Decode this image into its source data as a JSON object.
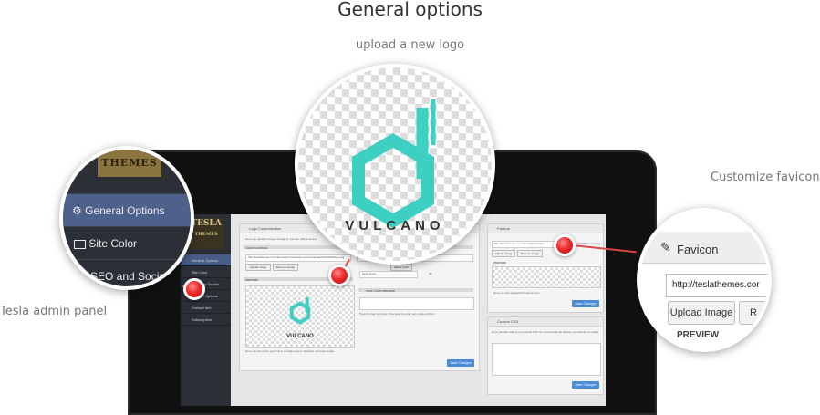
{
  "header": {
    "title": "General options",
    "subtitle": "upload a new logo"
  },
  "captions": {
    "favicon": "Customize favicon",
    "admin": "Tesla admin panel"
  },
  "lens_left": {
    "brand": "THEMES",
    "items": [
      {
        "label": "General Options",
        "icon": "gear-icon",
        "active": true
      },
      {
        "label": "Site Color",
        "icon": "image-icon",
        "active": false
      },
      {
        "label": "SEO and Socials",
        "icon": "",
        "active": false
      }
    ]
  },
  "lens_center": {
    "logo_text": "VULCANO",
    "logo_color": "#3ecfc3"
  },
  "lens_right": {
    "heading": "Favicon",
    "url_value": "http://teslathemes.cor",
    "upload_button": "Upload Image",
    "remove_button_partial": "R",
    "preview_label": "PREVIEW"
  },
  "admin": {
    "brand_top": "TESLA",
    "brand_bottom": "THEMES",
    "sidebar": [
      {
        "label": "General Options",
        "active": true
      },
      {
        "label": "Site Color",
        "active": false
      },
      {
        "label": "SEO and Socials",
        "active": false
      },
      {
        "label": "Custom Options",
        "active": false
      },
      {
        "label": "Contact Info",
        "active": false
      },
      {
        "label": "Subscription",
        "active": false
      }
    ],
    "logo_panel": {
      "heading": "Logo Customization",
      "intro": "Here you upload a image as logo or you can write it as text",
      "logo_as_image": "LOGO AS IMAGE",
      "logo_url": "http://teslathemes.com/demo/wp/vulcano/wp-content/uploads/2013/08/logo.png",
      "upload_image": "Upload Image",
      "remove_image": "Remove Image",
      "preview": "PREVIEW",
      "logo_text": "VULCANO",
      "preview_note": "Here you can insert your link to a image logo or upload a new logo image.",
      "select_color": "Select Color",
      "font_select": "Open Sans",
      "font_size": "30",
      "text_logo_preview": "TEXT LOGO PREVIEW",
      "text_logo_note": "Type the logo text here, then select a color, set a size and font",
      "save": "Save Changes"
    },
    "favicon_panel": {
      "heading": "Favicon",
      "url": "http://teslathemes.com/demo/wp/vulcano",
      "preview_url": "/wp/2013/08/favicon.png",
      "upload_image": "Upload Image",
      "remove_image": "Remove Image",
      "preview": "PREVIEW",
      "note": "Here you can upload the Favicon icon.",
      "save": "Save Changes"
    },
    "css_panel": {
      "heading": "Custom CSS",
      "note": "Here you can write your personal CSS for customizing the classes you choose to modify.",
      "save": "Save Changes"
    }
  }
}
